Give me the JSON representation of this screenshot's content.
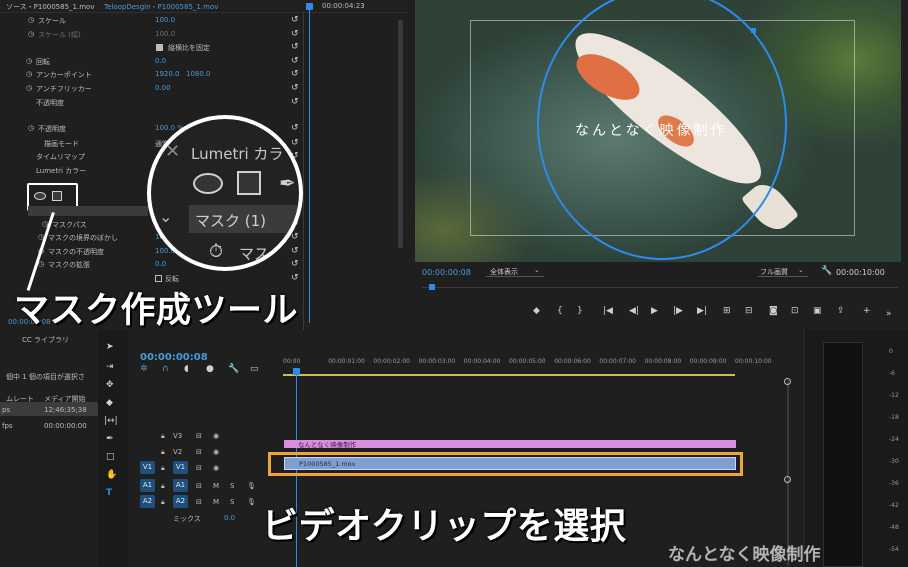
{
  "effect_controls": {
    "source_tab": "ソース・P1000585_1.mov",
    "clip_tab": "TeloopDesgin・P1000585_1.mov",
    "mini_timecode": "00:00:04:23",
    "rows": [
      {
        "label": "スケール",
        "value": "100.0",
        "dim": false
      },
      {
        "label": "スケール (幅)",
        "value": "100.0",
        "dim": true
      },
      {
        "label": "縦横比を固定",
        "value": "",
        "dim": false
      },
      {
        "label": "回転",
        "value": "0.0",
        "dim": false
      },
      {
        "label": "アンカーポイント",
        "value": "1920.0",
        "value2": "1080.0",
        "dim": false
      },
      {
        "label": "アンチフリッカー",
        "value": "0.00",
        "dim": false
      },
      {
        "label": "不透明度",
        "value": "",
        "dim": false
      },
      {
        "label": "不透明度",
        "value": "100.0 %",
        "dim": false
      },
      {
        "label": "描画モード",
        "value": "通常",
        "dim": false
      },
      {
        "label": "タイムリマップ",
        "value": "",
        "dim": false
      },
      {
        "label": "Lumetri カラー",
        "value": "",
        "dim": false
      },
      {
        "label": "マスク (1)",
        "value": "",
        "dim": false
      },
      {
        "label": "マスクパス",
        "value": "",
        "dim": false
      },
      {
        "label": "マスクの境界のぼかし",
        "value": "10.0",
        "dim": false
      },
      {
        "label": "マスクの不透明度",
        "value": "100.0",
        "dim": false
      },
      {
        "label": "マスクの拡張",
        "value": "0.0",
        "dim": false
      },
      {
        "label": "反転",
        "value": "",
        "dim": false
      }
    ],
    "bottom_timecode": "00:00:00:08"
  },
  "zoom": {
    "lumetri": "Lumetri カラ",
    "mask_label": "マスク (1)",
    "mask_sub": "マス"
  },
  "program": {
    "overlay_text": "なんとなく映像制作",
    "timecode": "00:00:00:08",
    "fit": "全体表示",
    "quality": "フル画質",
    "duration": "00:00:10:00"
  },
  "project": {
    "title": "CC ライブラリ",
    "info": "個中 1 個の項目が選択さ",
    "col1": "ムレート",
    "col2": "メディア開始",
    "row1_a": "ps",
    "row1_b": "12;46;35;38",
    "row2_a": "fps",
    "row2_b": "00:00:00:00"
  },
  "timeline": {
    "timecode": "00:00:00:08",
    "ruler": [
      "00:00",
      "00:00:01:00",
      "00:00:02:00",
      "00:00:03:00",
      "00:00:04:00",
      "00:00:05:00",
      "00:00:06:00",
      "00:00:07:00",
      "00:00:08:00",
      "00:00:09:00",
      "00:00:10:00"
    ],
    "tracks_video": [
      "V3",
      "V2",
      "V1"
    ],
    "tracks_audio": [
      "A1",
      "A2"
    ],
    "mix_label": "ミックス",
    "mix_value": "0.0",
    "title_clip": "なんとなく映像制作",
    "video_clip": "P1000585_1.mov",
    "meter": [
      "0",
      "-6",
      "-12",
      "-18",
      "-24",
      "-30",
      "-36",
      "-42",
      "-48",
      "-54"
    ]
  },
  "callouts": {
    "mask_tool": "マスク作成ツール",
    "select_clip": "ビデオクリップを選択"
  },
  "watermark": "なんとなく映像制作",
  "colors": {
    "accent_blue": "#2d8ceb",
    "clip_blue": "#7f9fd0",
    "clip_pink": "#d98ee0",
    "callout_orange": "#f2a33a",
    "track_blue": "#1f4f7d"
  }
}
